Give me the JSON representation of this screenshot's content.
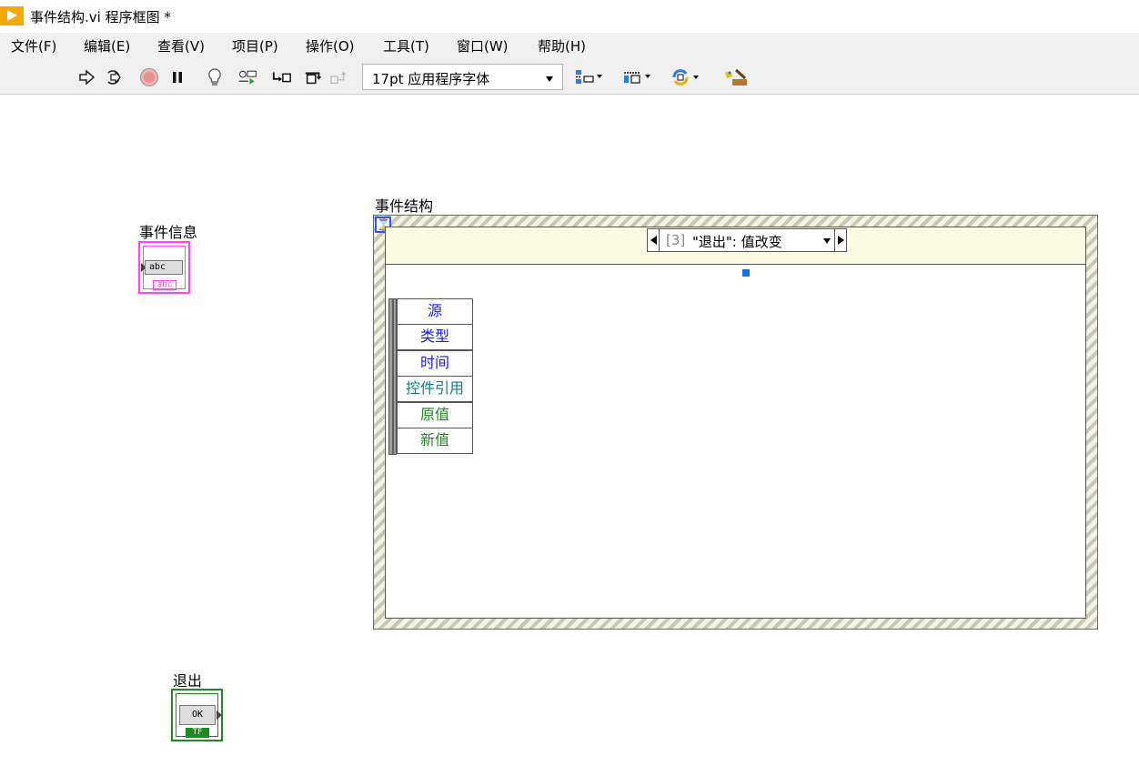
{
  "window": {
    "title": "事件结构.vi 程序框图 *"
  },
  "menubar": {
    "items": [
      "文件(F)",
      "编辑(E)",
      "查看(V)",
      "项目(P)",
      "操作(O)",
      "工具(T)",
      "窗口(W)",
      "帮助(H)"
    ]
  },
  "toolbar": {
    "font_select_value": "17pt 应用程序字体",
    "icons": [
      "run-arrow-icon",
      "run-continuously-icon",
      "abort-icon",
      "pause-icon",
      "highlight-execution-icon",
      "retain-wire-values-icon",
      "step-into-icon",
      "step-over-icon",
      "step-out-icon",
      "align-objects-icon",
      "distribute-objects-icon",
      "reorder-icon",
      "cleanup-diagram-icon"
    ]
  },
  "diagram": {
    "event_info_label": "事件信息",
    "event_info_field": "abc",
    "event_info_type": "abc",
    "exit_label": "退出",
    "exit_field": "OK",
    "exit_type": "TF",
    "structure_label": "事件结构",
    "timeout_glyph": "⌛",
    "selector_index": "[3]",
    "selector_text": "\"退出\": 值改变",
    "event_data_items": [
      {
        "label": "源",
        "color": "#1a1aff"
      },
      {
        "label": "类型",
        "color": "#1a1aff"
      },
      {
        "label": "时间",
        "color": "#1a1aff"
      },
      {
        "label": "控件引用",
        "color": "#108080"
      },
      {
        "label": "原值",
        "color": "#1f8a1f"
      },
      {
        "label": "新值",
        "color": "#1f8a1f"
      }
    ]
  },
  "colors": {
    "string_wire": "#ff40ff",
    "boolean_wire": "#1f8a1f",
    "structure_hatch": "#c8c8b4",
    "header_fill": "#fbfbe2",
    "tunnel": "#1a6fe0"
  }
}
